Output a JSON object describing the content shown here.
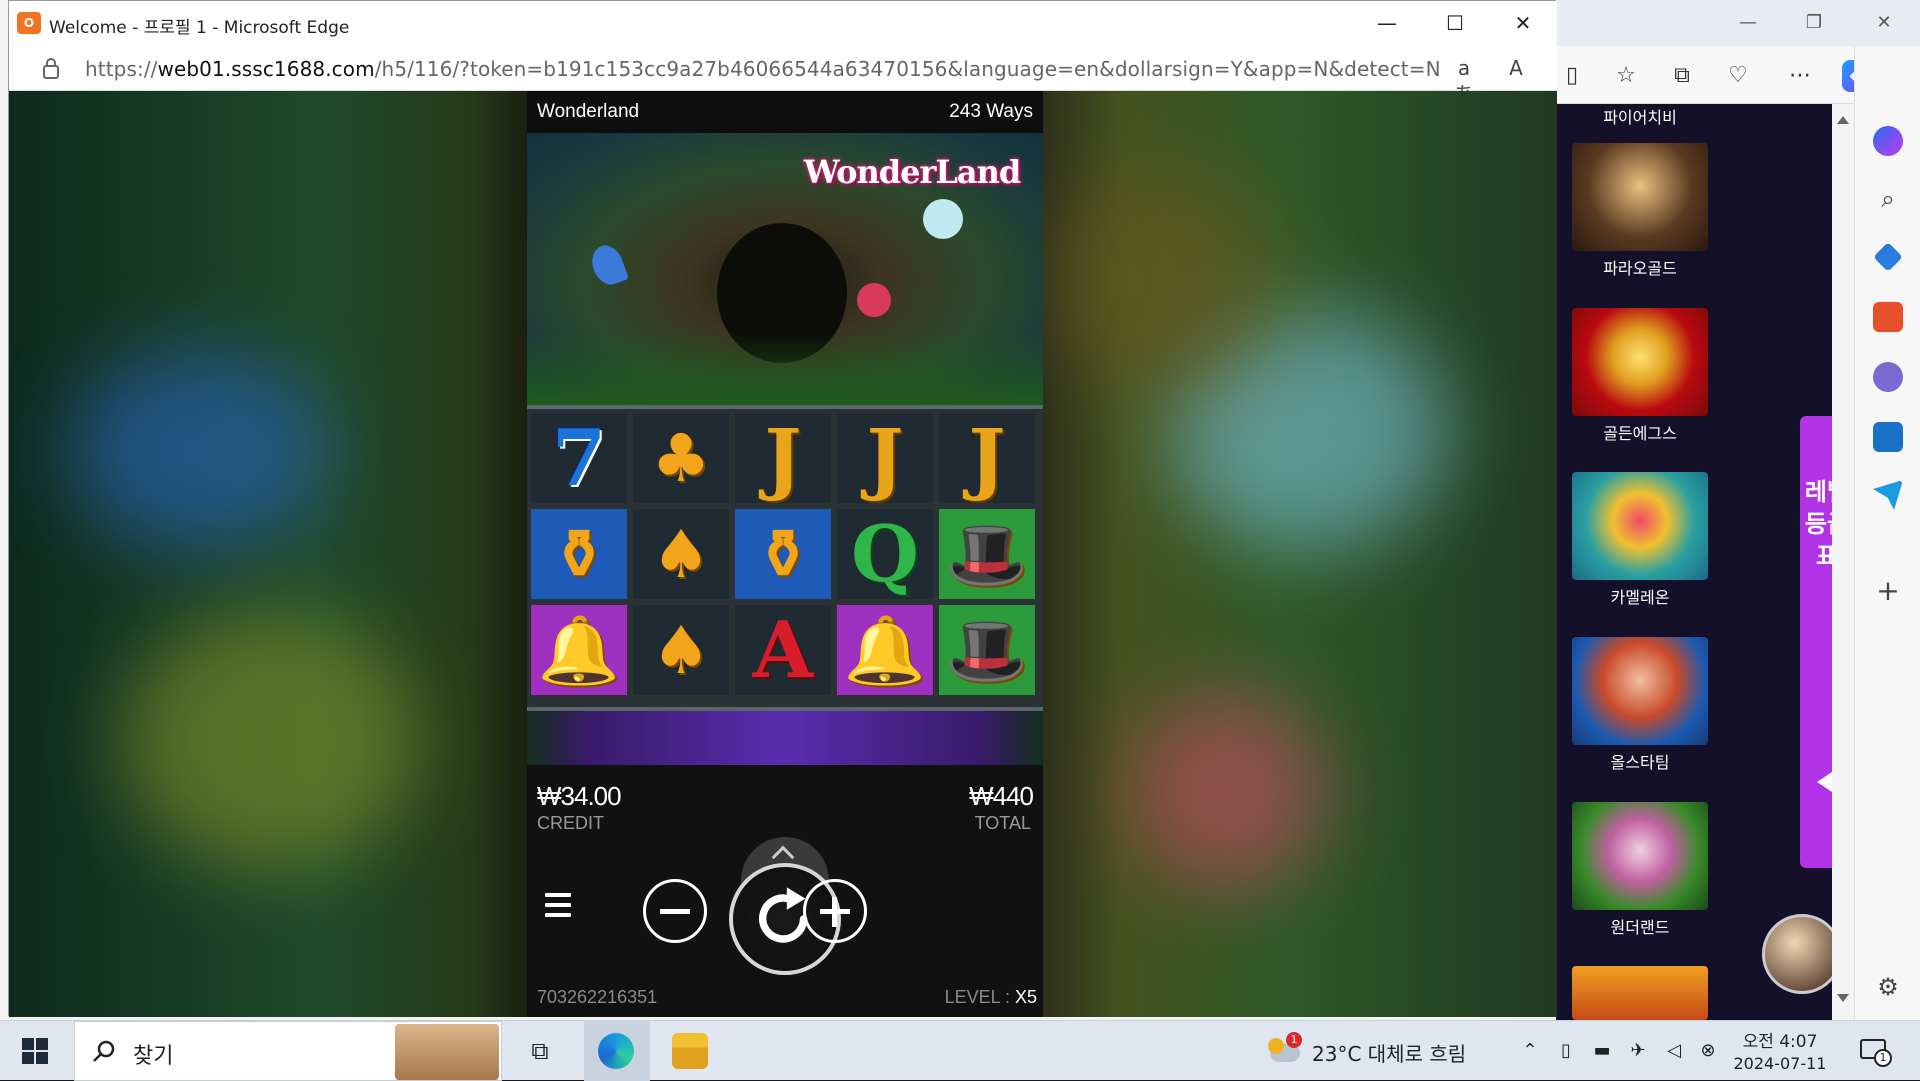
{
  "popup": {
    "title": "Welcome - 프로필 1 - Microsoft Edge",
    "logo_text": "O",
    "url_prefix": "https://",
    "url_host": "web01.sssc1688.com",
    "url_path": "/h5/116/?token=b191c153cc9a27b46066544a63470156&language=en&dollarsign=Y&app=N&detect=N",
    "read_aloud_label": "aあ",
    "immersive_label": "A"
  },
  "game": {
    "title": "Wonderland",
    "ways": "243 Ways",
    "logo": "WonderLand",
    "credit_value": "₩34.00",
    "credit_label": "CREDIT",
    "total_value": "₩440",
    "total_label": "TOTAL",
    "game_id": "703262216351",
    "level_label": "LEVEL : ",
    "level_value": "X5",
    "reels": [
      [
        "7",
        "♣",
        "J",
        "J",
        "J"
      ],
      [
        "⚱",
        "♠",
        "⚱",
        "Q",
        "🎩"
      ],
      [
        "🔔",
        "♠",
        "A",
        "🔔",
        "🎩"
      ]
    ],
    "reel_colors": {
      "bg_dark": "#1f2a33",
      "bg_blue": "#1e5ab8",
      "bg_purple": "#a030c0",
      "bg_green": "#2a9a3a"
    }
  },
  "side_list": {
    "top_name": "파이어치비",
    "items": [
      {
        "name": "파라오골드",
        "color_a": "#3a2a1a",
        "color_b": "#c9a040"
      },
      {
        "name": "골든에그스",
        "color_a": "#c81010",
        "color_b": "#f2c040"
      },
      {
        "name": "카멜레온",
        "color_a": "#2aa0c0",
        "color_b": "#c82a3a"
      },
      {
        "name": "올스타팀",
        "color_a": "#1a5ab0",
        "color_b": "#e84a2a"
      },
      {
        "name": "원더랜드",
        "color_a": "#3a8a2a",
        "color_b": "#f0c0d8"
      }
    ]
  },
  "level_tab": {
    "label": "레벨등급표"
  },
  "taskbar": {
    "search_placeholder": "찾기",
    "weather_temp": "23°C",
    "weather_desc": "대체로 흐림",
    "weather_badge": "1",
    "time": "오전 4:07",
    "date": "2024-07-11",
    "notif_count": "1"
  }
}
